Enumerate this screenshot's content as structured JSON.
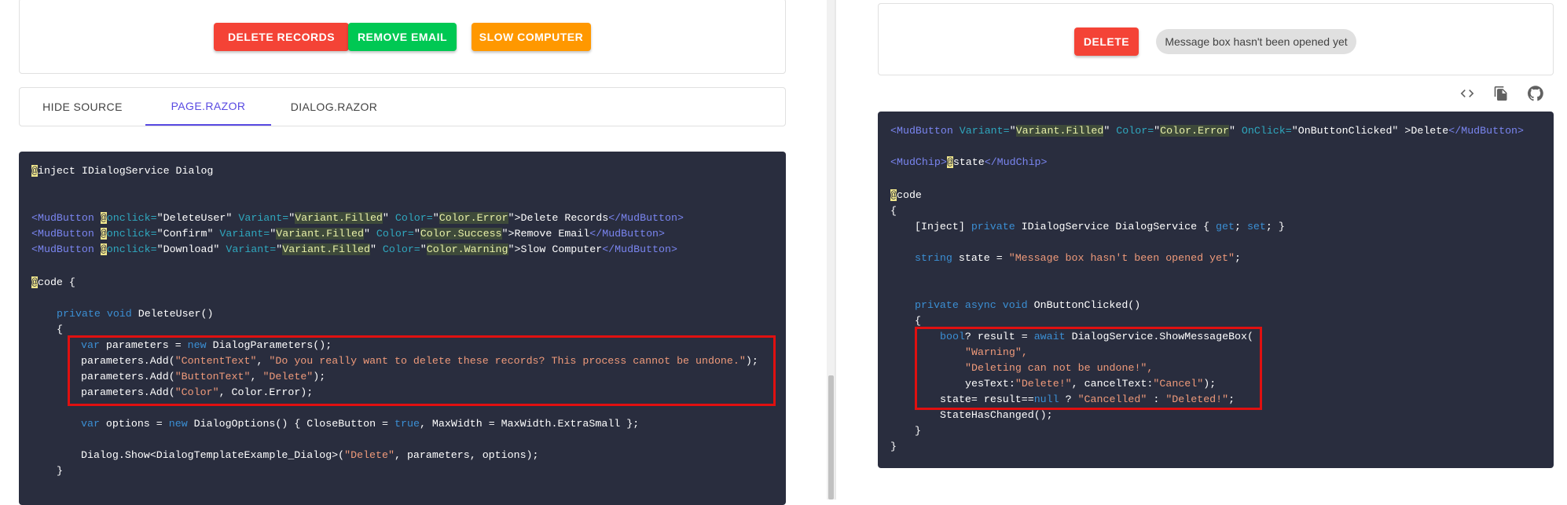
{
  "left": {
    "buttons": [
      {
        "label": "DELETE RECORDS",
        "color": "#f44336"
      },
      {
        "label": "REMOVE EMAIL",
        "color": "#00c853"
      },
      {
        "label": "SLOW COMPUTER",
        "color": "#ff9800"
      }
    ],
    "tabs": [
      {
        "label": "HIDE SOURCE",
        "active": false
      },
      {
        "label": "PAGE.RAZOR",
        "active": true
      },
      {
        "label": "DIALOG.RAZOR",
        "active": false
      }
    ],
    "code": {
      "l1a": "@",
      "l1b": "inject IDialogService Dialog",
      "l2": [
        {
          "tag": "<MudButton ",
          "at": "@",
          "on": "onclick=",
          "arg": "\"DeleteUser\"",
          "v": " Variant=",
          "vq1": "\"",
          "vv": "Variant.Filled",
          "vq2": "\"",
          "c": " Color=",
          "cq1": "\"",
          "cv": "Color.Error",
          "cq2": "\"",
          "txt": ">Delete Records",
          "end": "</MudButton>"
        },
        {
          "tag": "<MudButton ",
          "at": "@",
          "on": "onclick=",
          "arg": "\"Confirm\"",
          "v": " Variant=",
          "vq1": "\"",
          "vv": "Variant.Filled",
          "vq2": "\"",
          "c": " Color=",
          "cq1": "\"",
          "cv": "Color.Success",
          "cq2": "\"",
          "txt": ">Remove Email",
          "end": "</MudButton>"
        },
        {
          "tag": "<MudButton ",
          "at": "@",
          "on": "onclick=",
          "arg": "\"Download\"",
          "v": " Variant=",
          "vq1": "\"",
          "vv": "Variant.Filled",
          "vq2": "\"",
          "c": " Color=",
          "cq1": "\"",
          "cv": "Color.Warning",
          "cq2": "\"",
          "txt": ">Slow Computer",
          "end": "</MudButton>"
        }
      ],
      "code_at": "@",
      "code_kw": "code {",
      "m1a": "private void",
      "m1b": " DeleteUser()",
      "brace_open": "{",
      "p1a": "var",
      "p1b": " parameters = ",
      "p1c": "new",
      "p1d": " DialogParameters();",
      "p2a": "parameters.Add(",
      "p2b": "\"ContentText\"",
      "p2c": ", ",
      "p2d": "\"Do you really want to delete these records? This process cannot be undone.\"",
      "p2e": ");",
      "p3a": "parameters.Add(",
      "p3b": "\"ButtonText\"",
      "p3c": ", ",
      "p3d": "\"Delete\"",
      "p3e": ");",
      "p4a": "parameters.Add(",
      "p4b": "\"Color\"",
      "p4c": ", Color.Error);",
      "o1a": "var",
      "o1b": " options = ",
      "o1c": "new",
      "o1d": " DialogOptions() { CloseButton = ",
      "o1e": "true",
      "o1f": ", MaxWidth = MaxWidth.ExtraSmall };",
      "d1a": "Dialog.Show<DialogTemplateExample_Dialog>(",
      "d1b": "\"Delete\"",
      "d1c": ", parameters, options);",
      "brace_close": "}"
    }
  },
  "right": {
    "delete_label": "DELETE",
    "delete_color": "#f44336",
    "chip_text": "Message box hasn't been opened yet",
    "icons": [
      "code-icon",
      "copy-icon",
      "github-icon"
    ],
    "code": {
      "r1a": "<MudButton ",
      "r1b": "Variant=",
      "r1c": "\"",
      "r1d": "Variant.Filled",
      "r1e": "\"",
      "r1f": " Color=",
      "r1g": "\"",
      "r1h": "Color.Error",
      "r1i": "\"",
      "r1j": " OnClick=",
      "r1k": "\"OnButtonClicked\"",
      "r1l": " >Delete",
      "r1m": "</MudButton>",
      "r2a": "<MudChip>",
      "r2b": "@",
      "r2c": "state",
      "r2d": "</MudChip>",
      "r3a": "@",
      "r3b": "code",
      "r4": "{",
      "r5a": "[Inject] ",
      "r5b": "private",
      "r5c": " IDialogService DialogService { ",
      "r5d": "get",
      "r5e": "; ",
      "r5f": "set",
      "r5g": "; }",
      "r6a": "string",
      "r6b": " state = ",
      "r6c": "\"Message box hasn't been opened yet\"",
      "r6d": ";",
      "r7a": "private async void",
      "r7b": " OnButtonClicked()",
      "r8": "{",
      "r9a": "bool",
      "r9b": "? result = ",
      "r9c": "await",
      "r9d": " DialogService.ShowMessageBox(",
      "r10": "\"Warning\",",
      "r11": "\"Deleting can not be undone!\",",
      "r12a": "yesText:",
      "r12b": "\"Delete!\"",
      "r12c": ", cancelText:",
      "r12d": "\"Cancel\"",
      "r12e": ");",
      "r13a": "state= result==",
      "r13b": "null",
      "r13c": " ? ",
      "r13d": "\"Cancelled\"",
      "r13e": " : ",
      "r13f": "\"Deleted!\"",
      "r13g": ";",
      "r14": "StateHasChanged();",
      "r15": "}",
      "r16": "}"
    }
  }
}
